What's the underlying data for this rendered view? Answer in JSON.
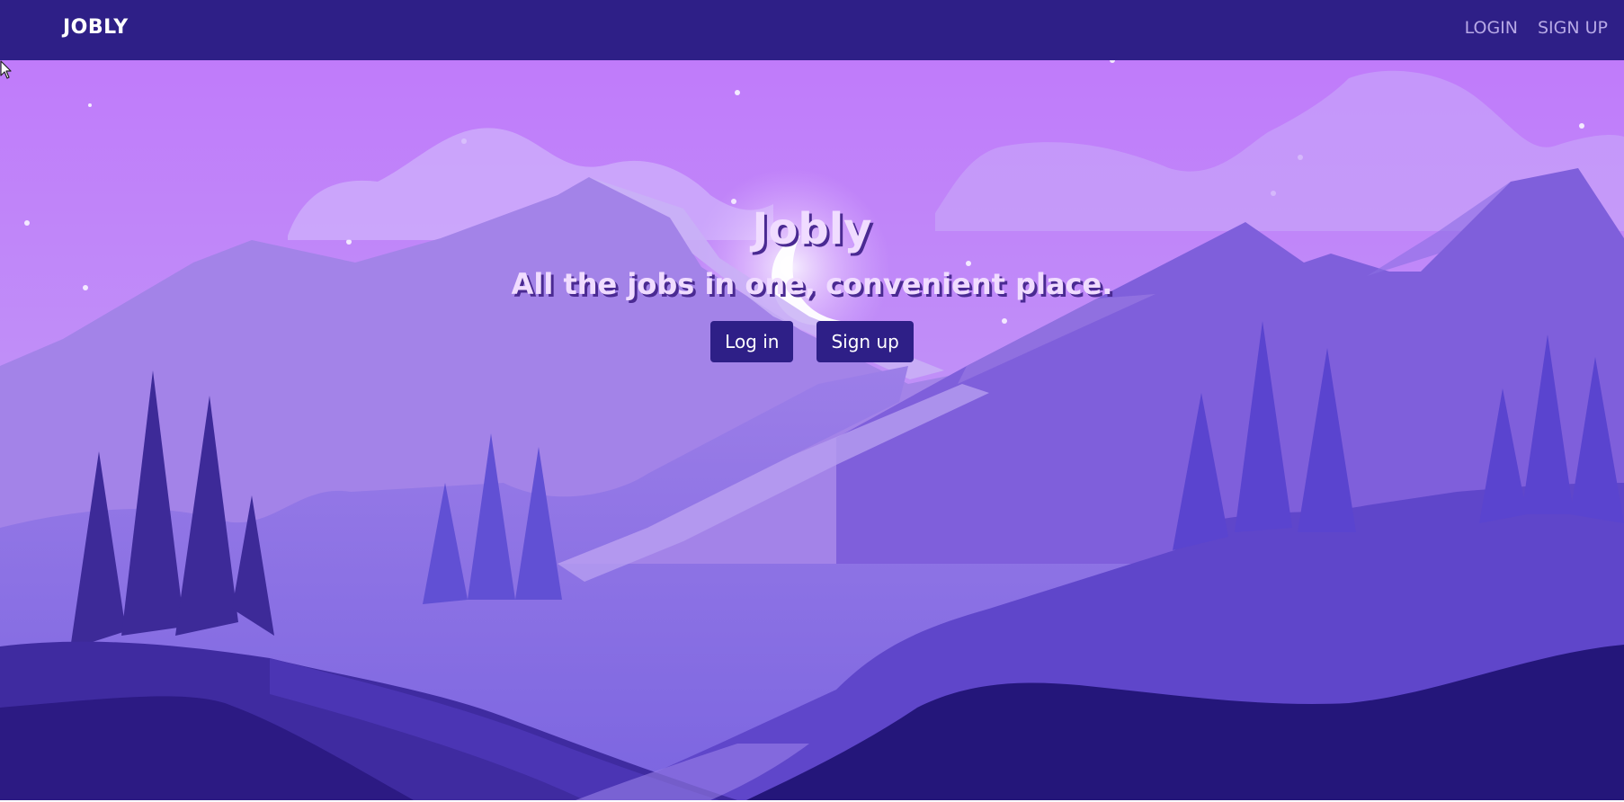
{
  "navbar": {
    "brand": "JOBLY",
    "links": [
      {
        "label": "LOGIN"
      },
      {
        "label": "SIGN UP"
      }
    ]
  },
  "hero": {
    "title": "Jobly",
    "tagline": "All the jobs in one, convenient place.",
    "buttons": {
      "login": "Log in",
      "signup": "Sign up"
    }
  },
  "colors": {
    "navbar_bg": "#2e1f87",
    "nav_link": "#b7a9e6",
    "button_bg": "#2e1f87",
    "sky_top": "#c07bfa",
    "sky_bottom": "#b79cf3",
    "heading_text": "#f0dcff"
  }
}
